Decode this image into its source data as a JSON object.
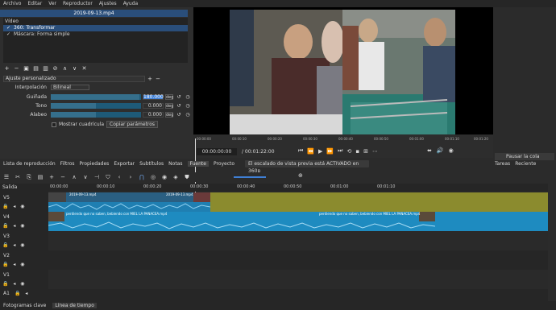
{
  "menu": [
    "Archivo",
    "Editar",
    "Ver",
    "Reproductor",
    "Ajustes",
    "Ayuda"
  ],
  "filters": {
    "clip_title": "2019-09-13.mp4",
    "list_header": "Vídeo",
    "items": [
      {
        "label": "360: Transformar",
        "checked": true,
        "selected": true
      },
      {
        "label": "Máscara: Forma simple",
        "checked": true,
        "selected": false
      }
    ],
    "toolbar_icons": [
      "add-icon",
      "remove-icon",
      "copy-icon",
      "paste-icon",
      "duplicate-icon",
      "deselect-icon",
      "up-icon",
      "down-icon",
      "close-icon"
    ],
    "toolbar_glyphs": [
      "+",
      "−",
      "▣",
      "▤",
      "▥",
      "⊘",
      "∧",
      "∨",
      "✕"
    ],
    "preset_label": "Ajuste personalizado",
    "interpolation_label": "Interpolación",
    "interpolation_value": "Bilineal",
    "params": [
      {
        "label": "Guiñada",
        "value": "180.000",
        "unit": "deg",
        "fraction": 0.98
      },
      {
        "label": "Tono",
        "value": "0.000",
        "unit": "deg",
        "fraction": 0.5
      },
      {
        "label": "Alabeo",
        "value": "0.000",
        "unit": "deg",
        "fraction": 0.5
      }
    ],
    "show_grid_label": "Mostrar cuadrícula",
    "copy_params_label": "Copiar parámetros"
  },
  "player": {
    "ruler_ticks": [
      "00:00:00",
      "00:00:10",
      "00:00:20",
      "00:00:30",
      "00:00:40",
      "00:00:50",
      "00:01:00",
      "00:01:10",
      "00:01:20"
    ],
    "timecode": "00:00:00:00",
    "duration": "/ 00:01:22:00",
    "transport": [
      "⏮",
      "⏪",
      "▶",
      "⏩",
      "⏭",
      "⟲",
      "▪",
      "⊞",
      "⋯"
    ],
    "volume_icons": [
      "⬌",
      "🔊",
      "◉"
    ]
  },
  "right_panel": {
    "pause_label": "Pausar la cola",
    "tabs": [
      "Tareas",
      "Reciente"
    ]
  },
  "tabs": [
    {
      "label": "Lista de reproducción",
      "active": false
    },
    {
      "label": "Filtros",
      "active": false
    },
    {
      "label": "Propiedades",
      "active": false
    },
    {
      "label": "Exportar",
      "active": false
    },
    {
      "label": "Subtítulos",
      "active": false
    },
    {
      "label": "Notas",
      "active": false
    },
    {
      "label": "Fuente",
      "active": true
    },
    {
      "label": "Proyecto",
      "active": false
    }
  ],
  "notice": "El escalado de vista previa está ACTIVADO en 360p",
  "timeline": {
    "output_label": "Salida",
    "ruler": [
      "00:00:00",
      "00:00:10",
      "00:00:20",
      "00:00:30",
      "00:00:40",
      "00:00:50",
      "00:01:00",
      "00:01:10"
    ],
    "tracks": [
      {
        "name": "V5",
        "kind": "video"
      },
      {
        "name": "V4",
        "kind": "video"
      },
      {
        "name": "V3",
        "kind": "video"
      },
      {
        "name": "V2",
        "kind": "video"
      },
      {
        "name": "V1",
        "kind": "video"
      },
      {
        "name": "A1",
        "kind": "audio"
      }
    ],
    "v5_clip_name": "2019-09-13.mp4",
    "v4_clip_name": "perdiendo que no saben, bebiendo con MIEL LA PANACEA.mp4",
    "v4_clip_name_short": "perdiendo que no saben, bebiendo con MIEL LA PANACEA.mp4"
  },
  "bottom_tabs": [
    {
      "label": "Fotogramas clave",
      "active": false
    },
    {
      "label": "Línea de tiempo",
      "active": true
    }
  ],
  "colors": {
    "selection": "#2a4e7a",
    "accent": "#3f7fd4",
    "track_yellow": "#8b8b2e",
    "clip_blue": "#1e8bc0"
  }
}
